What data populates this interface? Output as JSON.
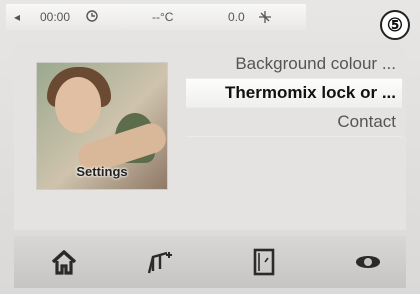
{
  "status_bar": {
    "back_symbol": "◂",
    "timer": "00:00",
    "temperature": "--°C",
    "weight": "0.0"
  },
  "step_marker": "⑤",
  "thumbnail": {
    "label": "Settings"
  },
  "menu": {
    "items": [
      {
        "label": "Background colour ..."
      },
      {
        "label": "Thermomix lock or ..."
      },
      {
        "label": "Contact"
      }
    ]
  },
  "nav": {
    "icons": [
      "home-icon",
      "scale-icon",
      "recipe-book-icon",
      "turbo-icon"
    ]
  }
}
